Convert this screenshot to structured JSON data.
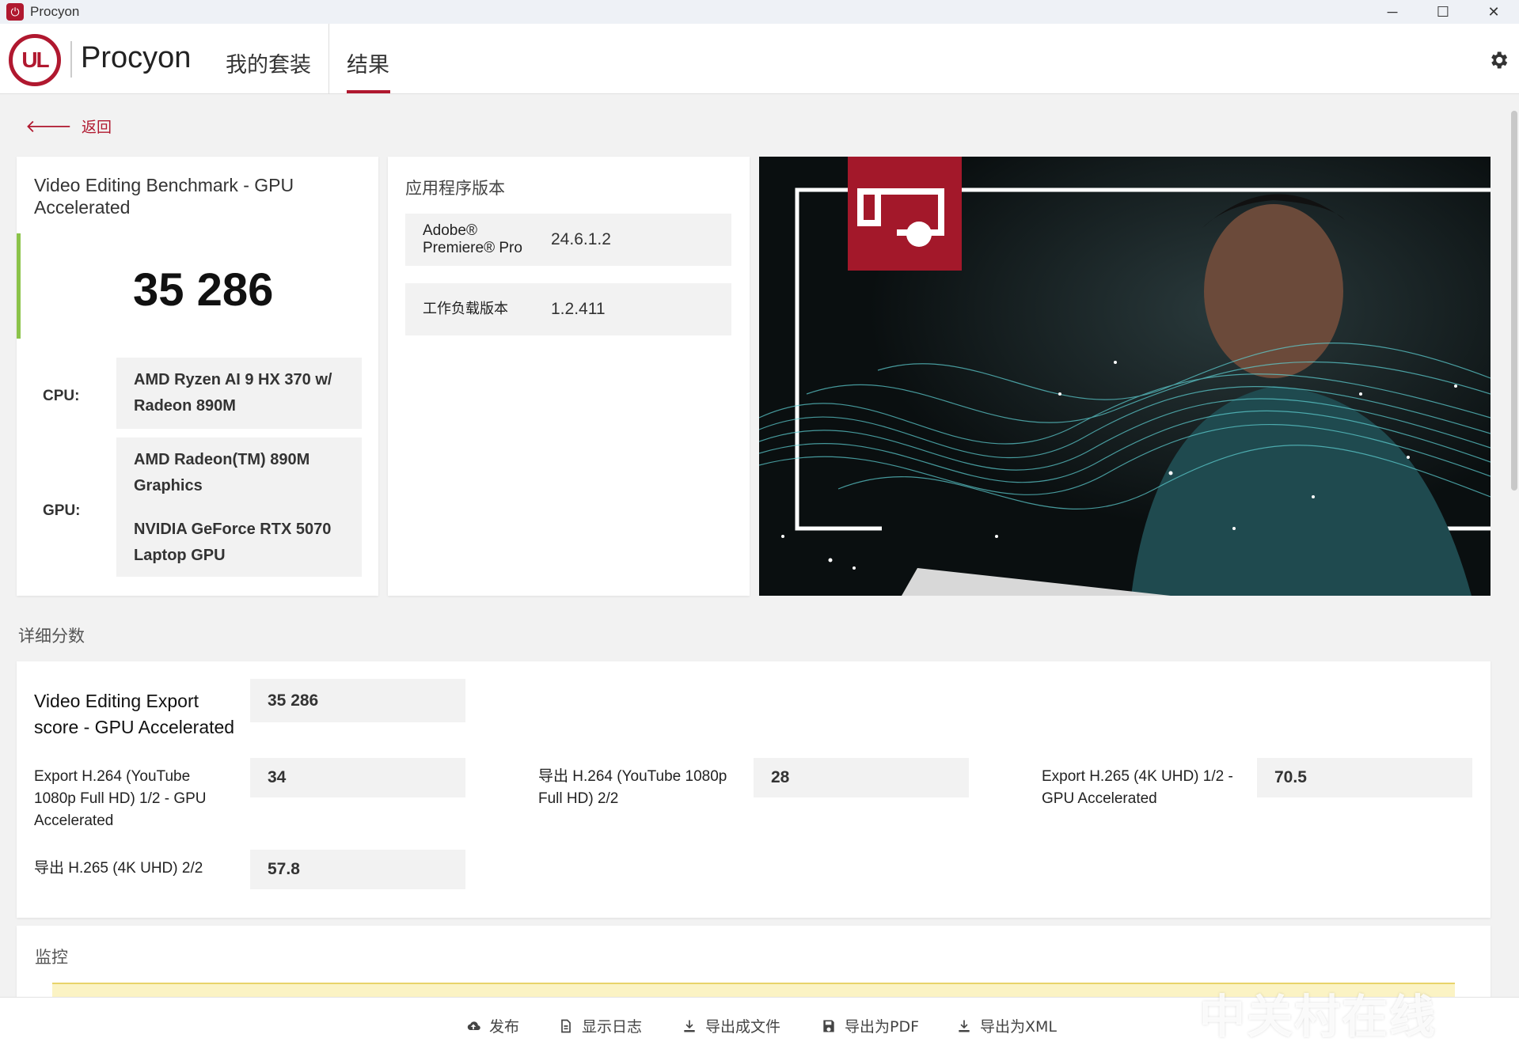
{
  "window": {
    "title": "Procyon",
    "minimize": "─",
    "maximize": "☐",
    "close": "✕"
  },
  "header": {
    "logo_text": "UL",
    "product": "Procyon",
    "tabs": [
      {
        "label": "我的套装"
      },
      {
        "label": "结果"
      }
    ],
    "accent": "#b0182f"
  },
  "back": {
    "label": "返回"
  },
  "benchmark": {
    "title": "Video Editing Benchmark - GPU Accelerated",
    "score": "35 286",
    "cpu_label": "CPU:",
    "cpu": "AMD Ryzen AI 9 HX 370 w/ Radeon 890M",
    "gpu_label": "GPU:",
    "gpus": [
      "AMD Radeon(TM) 890M Graphics",
      "NVIDIA GeForce RTX 5070 Laptop GPU"
    ]
  },
  "versions": {
    "title": "应用程序版本",
    "rows": [
      {
        "name": "Adobe® Premiere® Pro",
        "value": "24.6.1.2"
      },
      {
        "name": "工作负载版本",
        "value": "1.2.411"
      }
    ]
  },
  "details": {
    "title": "详细分数",
    "main_label": "Video Editing Export score - GPU Accelerated",
    "main_value": "35 286",
    "items": [
      {
        "label": "Export H.264 (YouTube 1080p Full HD) 1/2 - GPU Accelerated",
        "value": "34"
      },
      {
        "label": "导出 H.264 (YouTube 1080p Full HD) 2/2",
        "value": "28"
      },
      {
        "label": "Export H.265 (4K UHD) 1/2 - GPU Accelerated",
        "value": "70.5"
      },
      {
        "label": "导出 H.265 (4K UHD) 2/2",
        "value": "57.8"
      }
    ]
  },
  "monitor": {
    "title": "监控"
  },
  "toolbar": {
    "publish": "发布",
    "show_log": "显示日志",
    "export_file": "导出成文件",
    "export_pdf": "导出为PDF",
    "export_xml": "导出为XML"
  },
  "watermark": "中关村在线"
}
